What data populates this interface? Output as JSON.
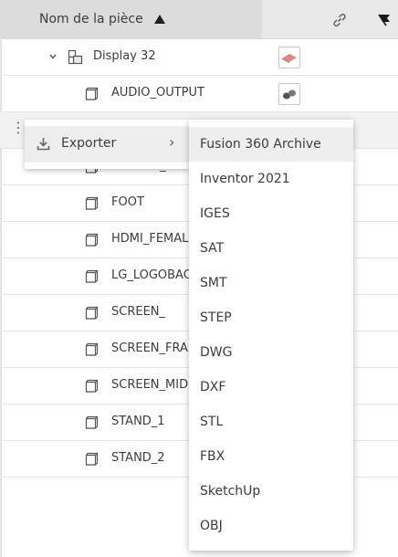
{
  "header": {
    "name_column": "Nom de la pièce",
    "link_icon": "link-icon",
    "flag_icon": "flag-icon"
  },
  "tree": {
    "parent": {
      "label": "Display 32",
      "icon": "assembly-icon",
      "expanded": true
    },
    "rows": [
      {
        "label": "AUDIO_OUTPUT",
        "has_thumb": true
      },
      {
        "label": "DISPLAY_FRONT"
      },
      {
        "label": "FOOT"
      },
      {
        "label": "HDMI_FEMALE"
      },
      {
        "label": "LG_LOGOBACK"
      },
      {
        "label": "SCREEN_"
      },
      {
        "label": "SCREEN_FRAME"
      },
      {
        "label": "SCREEN_MIDDLE"
      },
      {
        "label": "STAND_1"
      },
      {
        "label": "STAND_2"
      }
    ]
  },
  "context_menu": {
    "item": {
      "label": "Exporter",
      "icon": "download-icon",
      "arrow": "›"
    }
  },
  "export_menu": {
    "items": [
      "Fusion 360 Archive",
      "Inventor 2021",
      "IGES",
      "SAT",
      "SMT",
      "STEP",
      "DWG",
      "DXF",
      "STL",
      "FBX",
      "SketchUp",
      "OBJ"
    ],
    "active_index": 0
  },
  "colors": {
    "accent": "#0696d7",
    "header_bg": "#e9e9ea",
    "menu_hover": "#eeeeef"
  }
}
